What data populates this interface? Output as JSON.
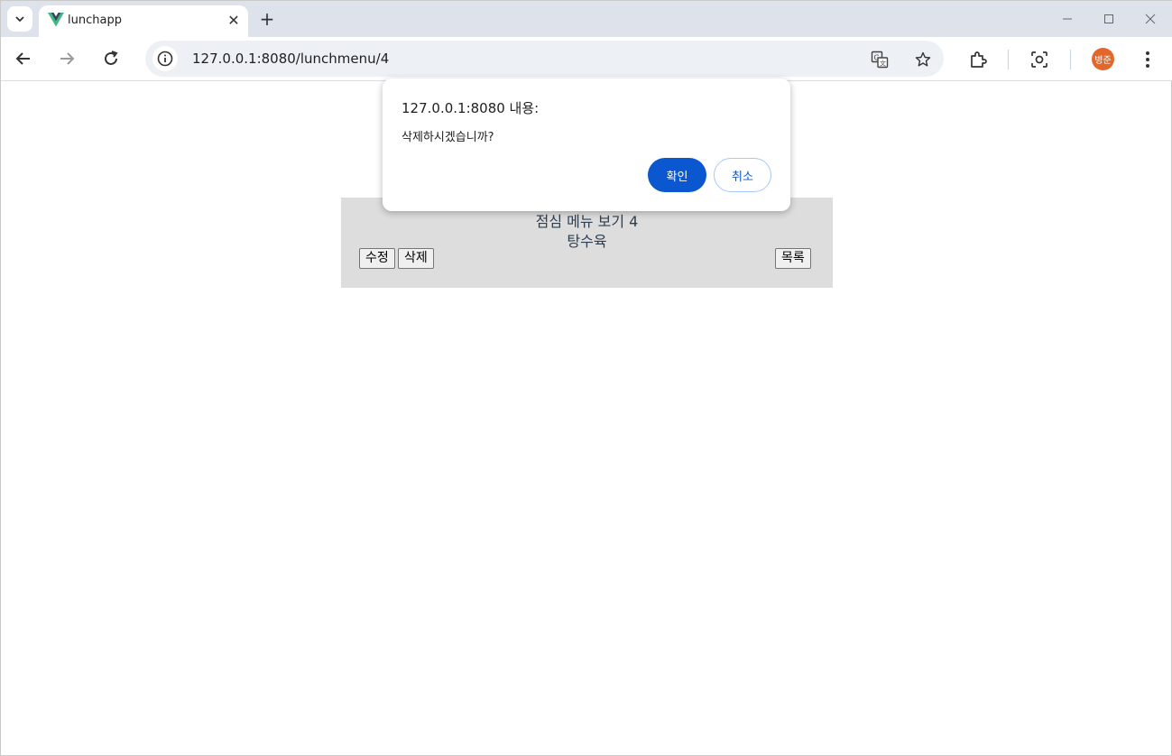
{
  "browser": {
    "tab": {
      "title": "lunchapp"
    },
    "address": {
      "url": "127.0.0.1:8080/lunchmenu/4"
    },
    "profile": {
      "initials": "병준",
      "color": "#e3672b"
    }
  },
  "page": {
    "title": "점심 메뉴 보기 4",
    "menu_name": "탕수육",
    "buttons": {
      "edit": "수정",
      "delete": "삭제",
      "list": "목록"
    }
  },
  "dialog": {
    "title": "127.0.0.1:8080 내용:",
    "message": "삭제하시겠습니까?",
    "ok": "확인",
    "cancel": "취소",
    "accent": "#0b57d0"
  }
}
